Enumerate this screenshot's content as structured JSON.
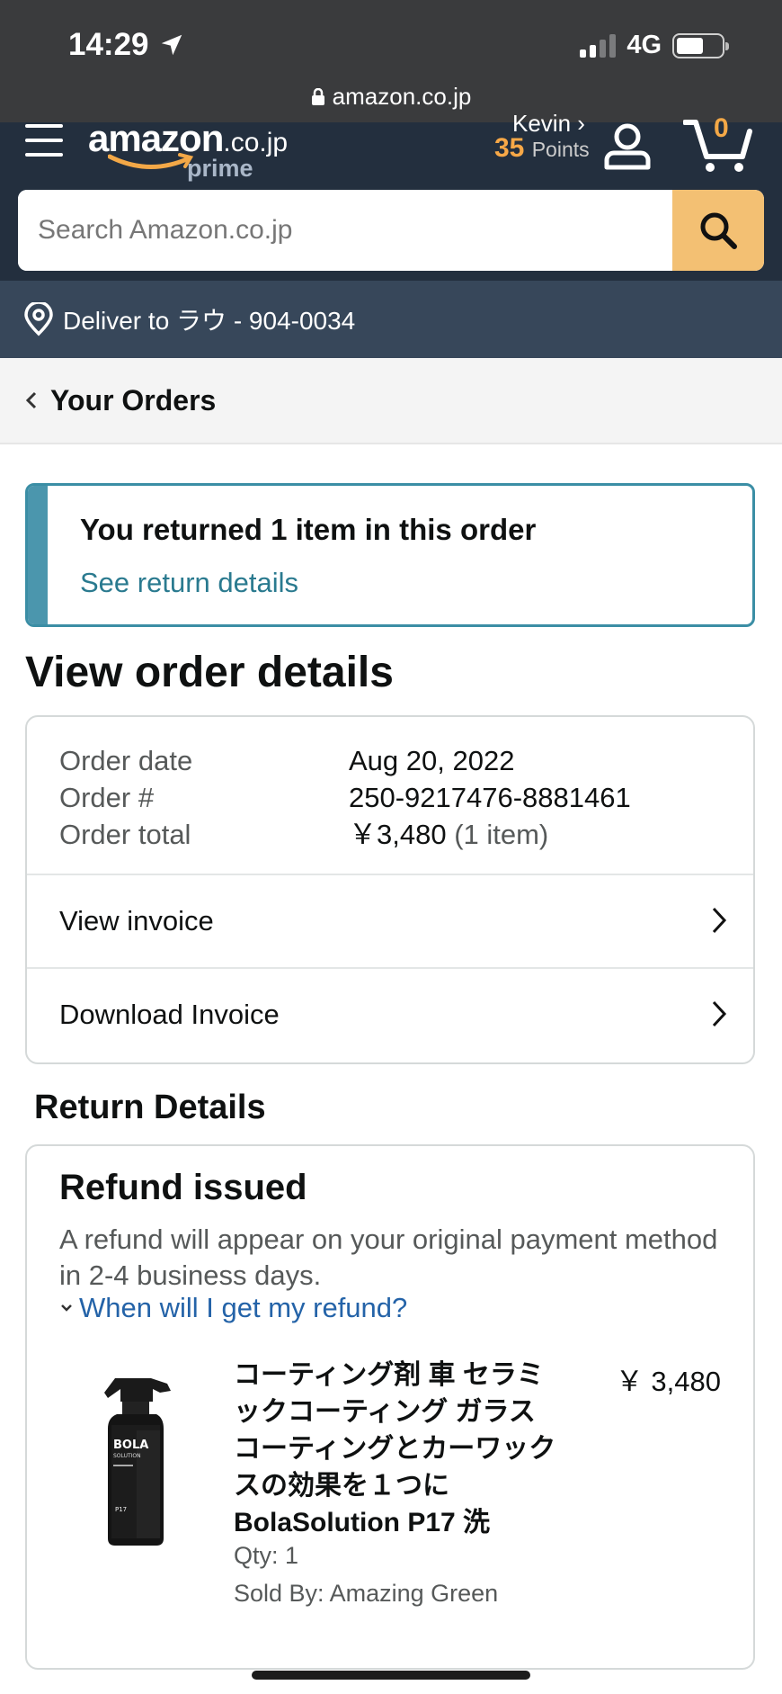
{
  "status_bar": {
    "time": "14:29",
    "network": "4G",
    "url": "amazon.co.jp"
  },
  "header": {
    "logo_word": "amazon",
    "logo_tld": ".co.jp",
    "logo_sub": "prime",
    "account_name": "Kevin ›",
    "points_value": "35",
    "points_label": "Points",
    "cart_count": "0",
    "search_placeholder": "Search Amazon.co.jp",
    "deliver_to": "Deliver to ラウ - 904-0034"
  },
  "breadcrumb": {
    "label": "Your Orders"
  },
  "return_banner": {
    "title": "You returned 1 item in this order",
    "link": "See return details"
  },
  "page_title": "View order details",
  "order": {
    "rows": [
      {
        "key": "Order date",
        "value": "Aug 20, 2022",
        "extra": ""
      },
      {
        "key": "Order #",
        "value": "250-9217476-8881461",
        "extra": ""
      },
      {
        "key": "Order total",
        "value": "￥3,480",
        "extra": " (1 item)"
      }
    ],
    "view_invoice": "View invoice",
    "download_invoice": "Download Invoice"
  },
  "return_details": {
    "section_title": "Return Details",
    "status": "Refund issued",
    "description": "A refund will appear on your original payment method in 2-4 business days.",
    "expand_link": "When will I get my refund?",
    "item": {
      "name": "コーティング剤 車 セラミックコーティング ガラスコーティングとカーワックスの効果を１つに BolaSolution P17 洗",
      "price": "￥ 3,480",
      "qty": "Qty: 1",
      "seller": "Sold By: Amazing Green",
      "bottle_brand": "BOLA",
      "bottle_sub": "SOLUTION",
      "bottle_code": "P17"
    }
  },
  "colors": {
    "header_bg": "#232f3e",
    "deliver_bg": "#37475a",
    "search_button": "#f3c073",
    "points": "#f7a847",
    "teal_accent": "#3b8ea5",
    "link_blue": "#2463a8"
  }
}
